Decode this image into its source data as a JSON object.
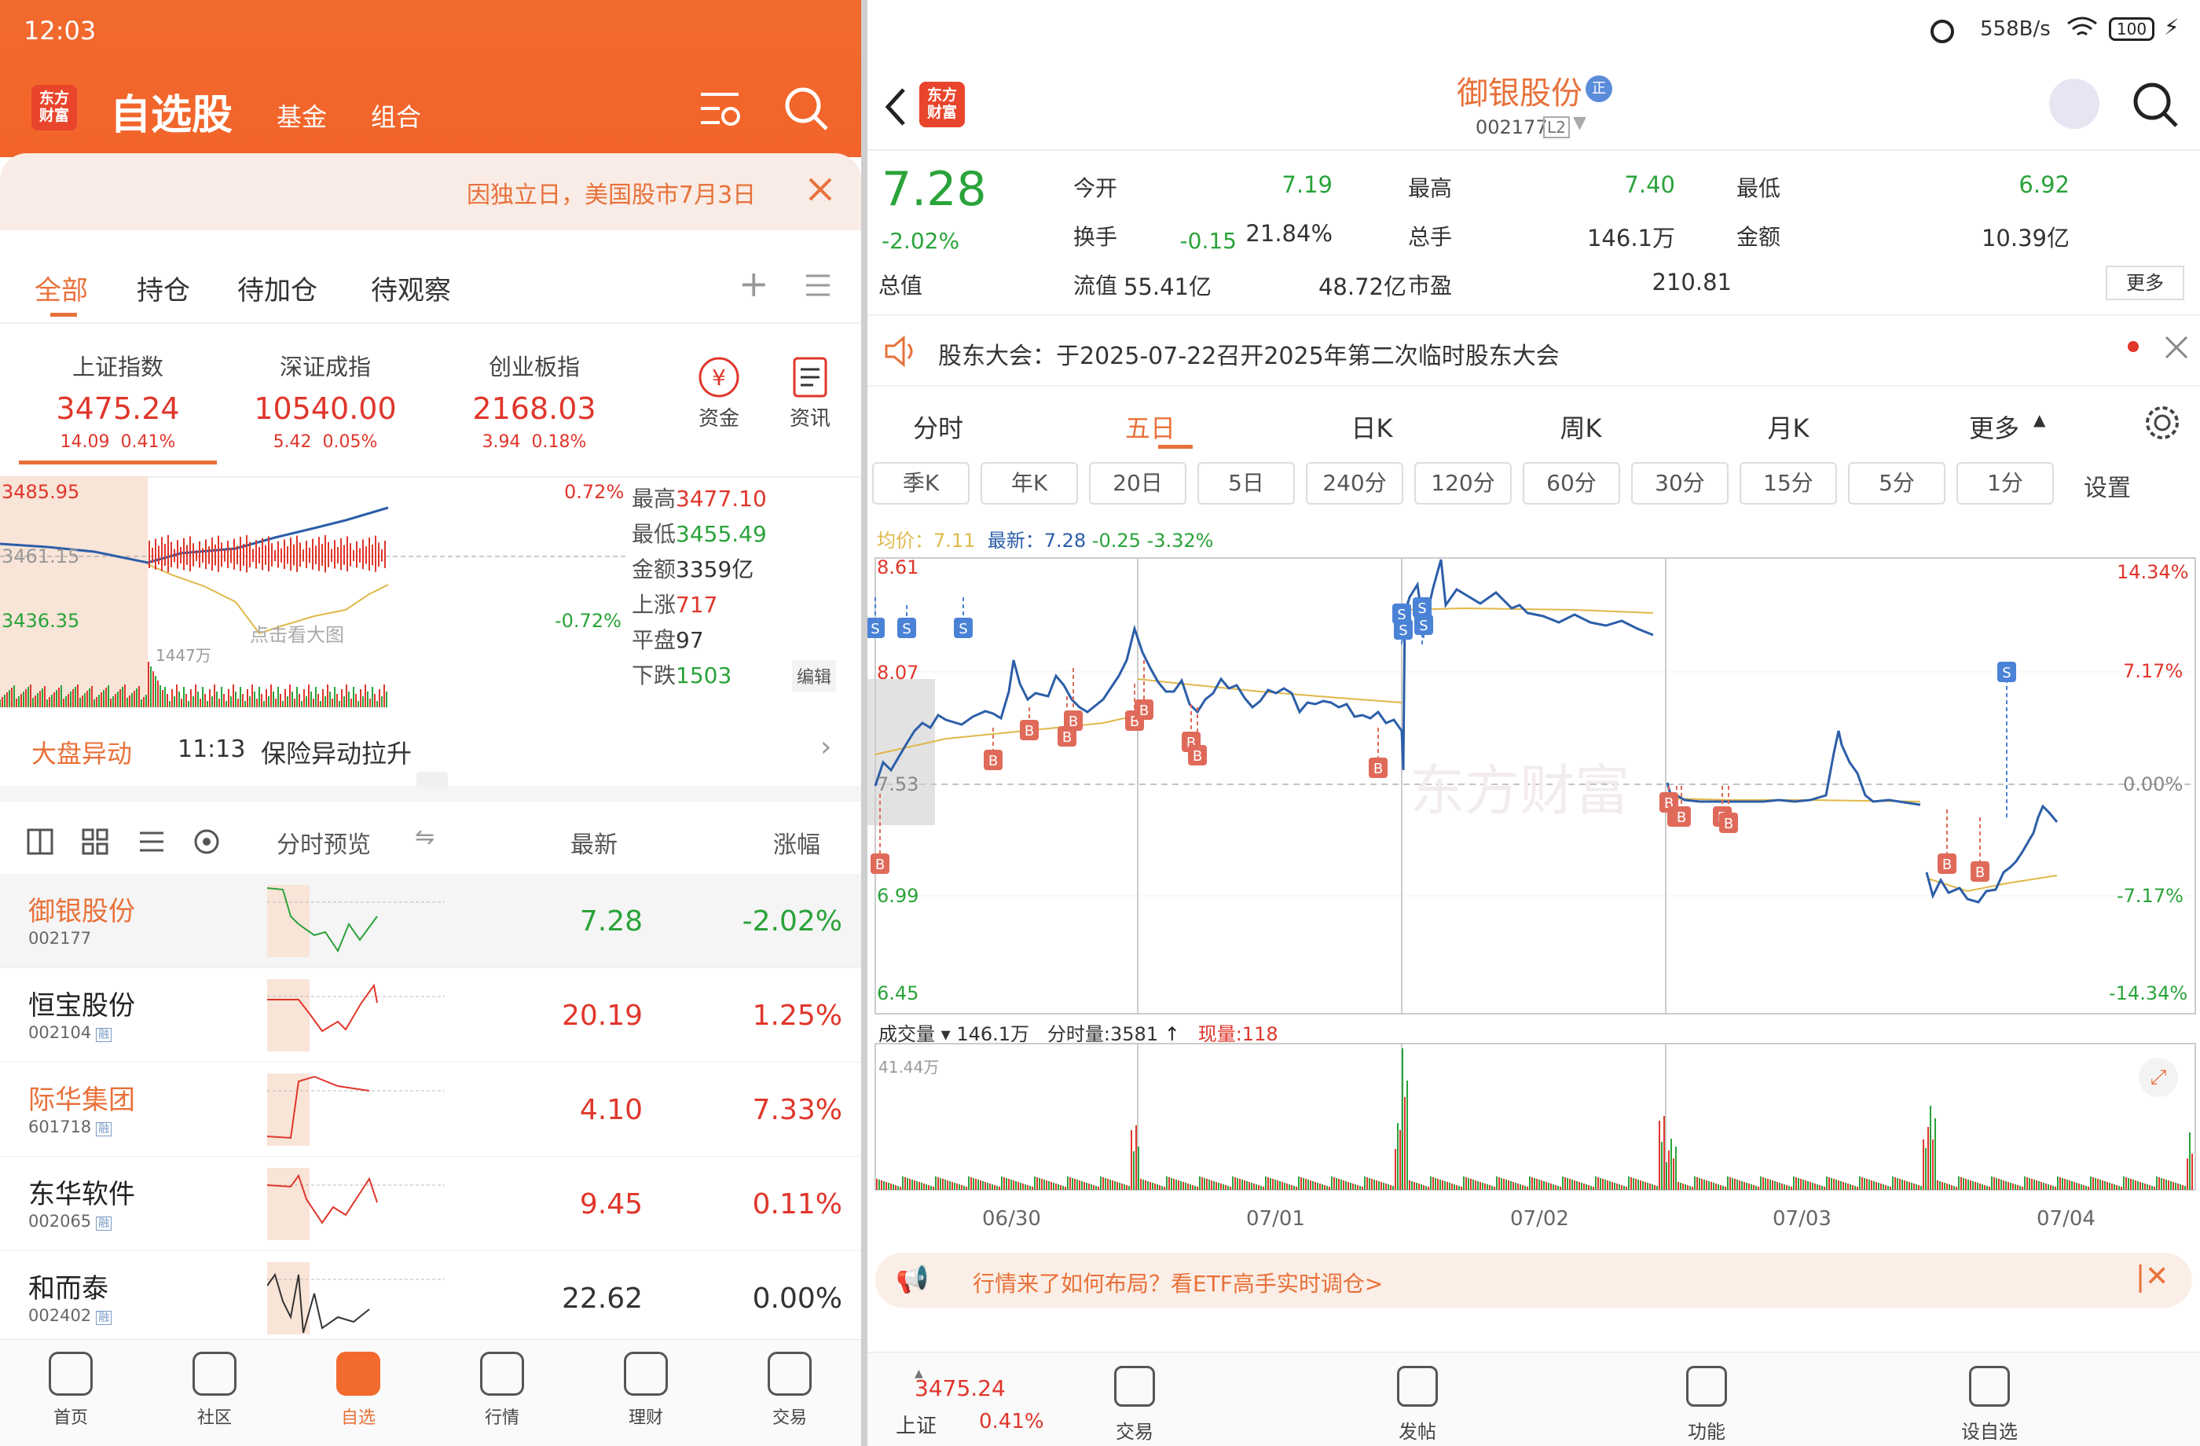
{
  "status": {
    "time": "12:03",
    "net": "558B/s",
    "battery": "100"
  },
  "left": {
    "title": "自选股",
    "tab_fund": "基金",
    "tab_combo": "组合",
    "banner": "因独立日，美国股市7月3日",
    "groups": [
      "全部",
      "持仓",
      "待加仓",
      "待观察"
    ],
    "indices": [
      {
        "name": "上证指数",
        "value": "3475.24",
        "chg": "14.09",
        "pct": "0.41%"
      },
      {
        "name": "深证成指",
        "value": "10540.00",
        "chg": "5.42",
        "pct": "0.05%"
      },
      {
        "name": "创业板指",
        "value": "2168.03",
        "chg": "3.94",
        "pct": "0.18%"
      }
    ],
    "tool_fund": "资金",
    "tool_news": "资讯",
    "mini": {
      "high_label": "3485.95",
      "low_label": "3436.35",
      "mid_label": "3461.15",
      "pct_up": "0.72%",
      "pct_dn": "-0.72%",
      "vol_label": "1447万",
      "watermark": "点击看大图",
      "stats": [
        {
          "k": "最高",
          "v": "3477.10"
        },
        {
          "k": "最低",
          "v": "3455.49"
        },
        {
          "k": "金额",
          "v": "3359亿"
        },
        {
          "k": "上涨",
          "v": "717"
        },
        {
          "k": "平盘",
          "v": "97"
        },
        {
          "k": "下跌",
          "v": "1503"
        }
      ],
      "edit": "编辑"
    },
    "market_move": {
      "label": "大盘异动",
      "time": "11:13",
      "text": "保险异动拉升"
    },
    "list_header": {
      "preview": "分时预览",
      "latest": "最新",
      "change": "涨幅"
    },
    "stocks": [
      {
        "name": "御银股份",
        "code": "002177",
        "price": "7.28",
        "pct": "-2.02%",
        "color": "green",
        "badge": ""
      },
      {
        "name": "恒宝股份",
        "code": "002104",
        "price": "20.19",
        "pct": "1.25%",
        "color": "red",
        "badge": "融"
      },
      {
        "name": "际华集团",
        "code": "601718",
        "price": "4.10",
        "pct": "7.33%",
        "color": "red",
        "badge": "融"
      },
      {
        "name": "东华软件",
        "code": "002065",
        "price": "9.45",
        "pct": "0.11%",
        "color": "red",
        "badge": "融"
      },
      {
        "name": "和而泰",
        "code": "002402",
        "price": "22.62",
        "pct": "0.00%",
        "color": "black",
        "badge": "融"
      }
    ],
    "nav": [
      "首页",
      "社区",
      "自选",
      "行情",
      "理财",
      "交易"
    ]
  },
  "right": {
    "stock_name": "御银股份",
    "stock_code": "002177",
    "code_badge": "L2",
    "price": "7.28",
    "pct": "-2.02%",
    "chg": "-0.15",
    "quote": [
      {
        "k": "今开",
        "v": "7.19",
        "c": "green"
      },
      {
        "k": "最高",
        "v": "7.40",
        "c": "green"
      },
      {
        "k": "最低",
        "v": "6.92",
        "c": "green"
      },
      {
        "k": "换手",
        "v": "21.84%",
        "c": "black"
      },
      {
        "k": "总手",
        "v": "146.1万",
        "c": "black"
      },
      {
        "k": "金额",
        "v": "10.39亿",
        "c": "black"
      },
      {
        "k": "总值",
        "v": "55.41亿",
        "c": "black"
      },
      {
        "k": "流值",
        "v": "48.72亿",
        "c": "black"
      },
      {
        "k": "市盈",
        "v": "210.81",
        "c": "black"
      }
    ],
    "more": "更多",
    "notice": "股东大会：于2025-07-22召开2025年第二次临时股东大会",
    "periods": [
      "分时",
      "五日",
      "日K",
      "周K",
      "月K",
      "更多"
    ],
    "buttons": [
      "季K",
      "年K",
      "20日",
      "5日",
      "240分",
      "120分",
      "60分",
      "30分",
      "15分",
      "5分",
      "1分"
    ],
    "settings_label": "设置",
    "legend": {
      "avg_label": "均价：7.11",
      "latest": "最新：7.28",
      "chg": "-0.25",
      "pct": "-3.32%"
    },
    "axis": {
      "y_top": "8.61",
      "y_mid": "8.07",
      "y_ref": "7.53",
      "y_low": "6.99",
      "y_bot": "6.45",
      "p_top": "14.34%",
      "p_u": "7.17%",
      "p_0": "0.00%",
      "p_d": "-7.17%",
      "p_bot": "-14.34%"
    },
    "dates": [
      "06/30",
      "07/01",
      "07/02",
      "07/03",
      "07/04"
    ],
    "vol": {
      "label": "成交量",
      "total": "146.1万",
      "fenshi": "分时量:3581",
      "xian": "现量:118",
      "max": "41.44万"
    },
    "ad": "行情来了如何布局？看ETF高手实时调仓>",
    "bottom_index": {
      "value": "3475.24",
      "name": "上证",
      "pct": "0.41%"
    },
    "bnav": [
      "交易",
      "发帖",
      "功能",
      "设自选"
    ]
  }
}
